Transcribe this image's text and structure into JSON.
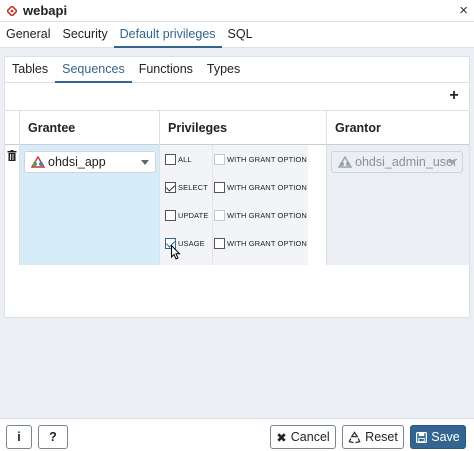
{
  "window": {
    "title": "webapi",
    "close_glyph": "×",
    "logo_icon": "diamond-logo-icon"
  },
  "top_tabs": [
    {
      "label": "General",
      "active": false
    },
    {
      "label": "Security",
      "active": false
    },
    {
      "label": "Default privileges",
      "active": true
    },
    {
      "label": "SQL",
      "active": false
    }
  ],
  "inner_tabs": [
    {
      "label": "Tables",
      "active": false
    },
    {
      "label": "Sequences",
      "active": true
    },
    {
      "label": "Functions",
      "active": false
    },
    {
      "label": "Types",
      "active": false
    }
  ],
  "toolbar": {
    "add_glyph": "+"
  },
  "grid": {
    "headers": {
      "grantee": "Grantee",
      "privileges": "Privileges",
      "grantor": "Grantor"
    },
    "row": {
      "grantee": "ohdsi_app",
      "grantor": "ohdsi_admin_user",
      "privileges": [
        {
          "label": "ALL",
          "checked": false,
          "with_grant_label": "WITH GRANT OPTION",
          "with_grant_checked": false,
          "with_grant_enabled": false
        },
        {
          "label": "SELECT",
          "checked": true,
          "with_grant_label": "WITH GRANT OPTION",
          "with_grant_checked": false,
          "with_grant_enabled": true
        },
        {
          "label": "UPDATE",
          "checked": false,
          "with_grant_label": "WITH GRANT OPTION",
          "with_grant_checked": false,
          "with_grant_enabled": false
        },
        {
          "label": "USAGE",
          "checked": true,
          "with_grant_label": "WITH GRANT OPTION",
          "with_grant_checked": false,
          "with_grant_enabled": true
        }
      ]
    }
  },
  "footer": {
    "info_label": "i",
    "help_label": "?",
    "cancel_label": "Cancel",
    "reset_label": "Reset",
    "save_label": "Save"
  },
  "colors": {
    "accent": "#326690",
    "selected_cell": "#d7ecf9",
    "panel_bg": "#ebeef3"
  }
}
